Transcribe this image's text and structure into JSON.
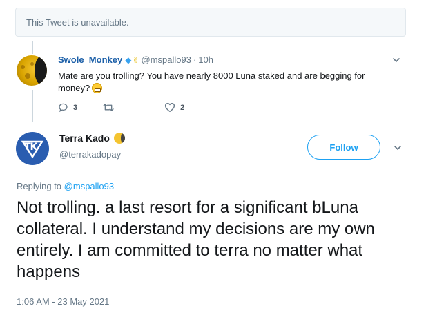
{
  "unavailable_notice": "This Tweet is unavailable.",
  "reply": {
    "name": "Swole_Monkey",
    "badges": [
      "gem-icon",
      "raising-hands-icon"
    ],
    "handle": "@mspallo93",
    "separator": "·",
    "time": "10h",
    "text": "Mate are you trolling? You have nearly 8000 Luna staked and are begging for money?",
    "emoji": "grimacing-face-icon",
    "counts": {
      "replies": "3",
      "retweets": "",
      "likes": "2"
    }
  },
  "tweet": {
    "name": "Terra Kado",
    "name_emoji": "moon-icon",
    "handle": "@terrakadopay",
    "follow_label": "Follow",
    "replying_prefix": "Replying to",
    "replying_handle": "@mspallo93",
    "text": "Not trolling. a last resort for a significant bLuna collateral. I understand my decisions are my own entirely. I am committed to terra no matter what happens",
    "timestamp": "1:06 AM - 23 May 2021"
  },
  "colors": {
    "accent": "#1da1f2",
    "link_dark": "#1b5fa8",
    "muted": "#657786",
    "text": "#14171a"
  }
}
